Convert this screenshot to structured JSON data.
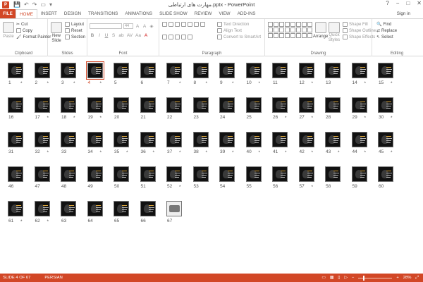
{
  "window": {
    "title": "مهارت های ارتباطی.pptx - PowerPoint",
    "controls": [
      "?",
      "−",
      "□",
      "✕"
    ]
  },
  "tabs": {
    "file": "FILE",
    "items": [
      "HOME",
      "INSERT",
      "DESIGN",
      "TRANSITIONS",
      "ANIMATIONS",
      "SLIDE SHOW",
      "REVIEW",
      "VIEW",
      "ADD-INS"
    ],
    "active": "HOME",
    "sign_in": "Sign in"
  },
  "ribbon": {
    "clipboard": {
      "paste": "Paste",
      "cut": "Cut",
      "copy": "Copy",
      "format_painter": "Format Painter",
      "label": "Clipboard"
    },
    "slides": {
      "new_slide": "New",
      "new_slide_2": "Slide",
      "layout": "Layout",
      "reset": "Reset",
      "section": "Section",
      "label": "Slides"
    },
    "font": {
      "size": "44",
      "label": "Font",
      "row2": [
        "B",
        "I",
        "U",
        "S",
        "ab",
        "AV",
        "Aa",
        "A"
      ]
    },
    "paragraph": {
      "text_direction": "Text Direction",
      "align_text": "Align Text",
      "convert_smartart": "Convert to SmartArt",
      "label": "Paragraph"
    },
    "drawing": {
      "arrange": "Arrange",
      "quick_styles": "Quick Styles",
      "shape_fill": "Shape Fill",
      "shape_outline": "Shape Outline",
      "shape_effects": "Shape Effects",
      "label": "Drawing"
    },
    "editing": {
      "find": "Find",
      "replace": "Replace",
      "select": "Select",
      "label": "Editing"
    }
  },
  "accent_color": "#d24726",
  "sorter": {
    "total_slides": 67,
    "selected_slide": 4,
    "slides": [
      {
        "n": "1",
        "star": true
      },
      {
        "n": "2",
        "star": true
      },
      {
        "n": "3",
        "star": true
      },
      {
        "n": "4",
        "star": true
      },
      {
        "n": "5",
        "star": false
      },
      {
        "n": "6",
        "star": false
      },
      {
        "n": "7",
        "star": true
      },
      {
        "n": "8",
        "star": true
      },
      {
        "n": "9",
        "star": true
      },
      {
        "n": "10",
        "star": true
      },
      {
        "n": "11",
        "star": false
      },
      {
        "n": "12",
        "star": true
      },
      {
        "n": "13",
        "star": false
      },
      {
        "n": "14",
        "star": true
      },
      {
        "n": "15",
        "star": true
      },
      {
        "n": "16",
        "star": false
      },
      {
        "n": "17",
        "star": true
      },
      {
        "n": "18",
        "star": true
      },
      {
        "n": "19",
        "star": true
      },
      {
        "n": "20",
        "star": false
      },
      {
        "n": "21",
        "star": false
      },
      {
        "n": "22",
        "star": false
      },
      {
        "n": "23",
        "star": false
      },
      {
        "n": "24",
        "star": false
      },
      {
        "n": "25",
        "star": false
      },
      {
        "n": "26",
        "star": true
      },
      {
        "n": "27",
        "star": true
      },
      {
        "n": "28",
        "star": false
      },
      {
        "n": "29",
        "star": true
      },
      {
        "n": "30",
        "star": true
      },
      {
        "n": "31",
        "star": false
      },
      {
        "n": "32",
        "star": true
      },
      {
        "n": "33",
        "star": false
      },
      {
        "n": "34",
        "star": true
      },
      {
        "n": "35",
        "star": true
      },
      {
        "n": "36",
        "star": true
      },
      {
        "n": "37",
        "star": true
      },
      {
        "n": "38",
        "star": true
      },
      {
        "n": "39",
        "star": true
      },
      {
        "n": "40",
        "star": true
      },
      {
        "n": "41",
        "star": true
      },
      {
        "n": "42",
        "star": true
      },
      {
        "n": "43",
        "star": true
      },
      {
        "n": "44",
        "star": true
      },
      {
        "n": "45",
        "star": true
      },
      {
        "n": "46",
        "star": false
      },
      {
        "n": "47",
        "star": false
      },
      {
        "n": "48",
        "star": false
      },
      {
        "n": "49",
        "star": false
      },
      {
        "n": "50",
        "star": false
      },
      {
        "n": "51",
        "star": false
      },
      {
        "n": "52",
        "star": true
      },
      {
        "n": "53",
        "star": false
      },
      {
        "n": "54",
        "star": false
      },
      {
        "n": "55",
        "star": false
      },
      {
        "n": "56",
        "star": false
      },
      {
        "n": "57",
        "star": true
      },
      {
        "n": "58",
        "star": false
      },
      {
        "n": "59",
        "star": false
      },
      {
        "n": "60",
        "star": false
      },
      {
        "n": "61",
        "star": true
      },
      {
        "n": "62",
        "star": true
      },
      {
        "n": "63",
        "star": false
      },
      {
        "n": "64",
        "star": false
      },
      {
        "n": "65",
        "star": false
      },
      {
        "n": "66",
        "star": false
      },
      {
        "n": "67",
        "star": false
      }
    ]
  },
  "status": {
    "slide_info": "SLIDE 4 OF 67",
    "language": "PERSIAN",
    "zoom": "28%",
    "zoom_fraction": 0.28
  }
}
